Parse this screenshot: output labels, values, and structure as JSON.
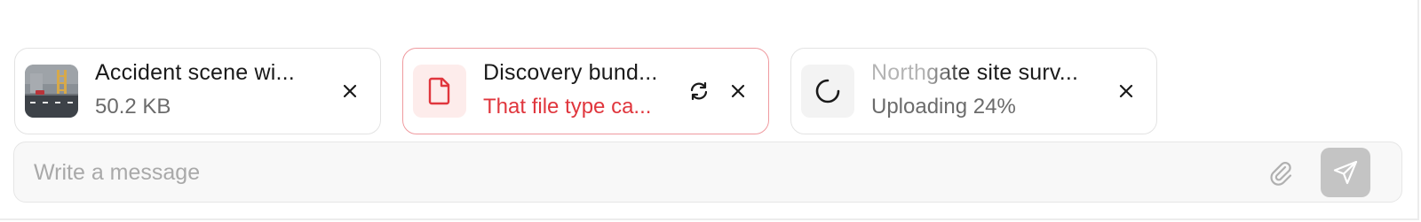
{
  "attachments": [
    {
      "name": "Accident scene wi...",
      "detail": "50.2 KB",
      "status": "uploaded",
      "thumbnail": "road-scene-image",
      "remove_icon": "close-icon"
    },
    {
      "name": "Discovery bund...",
      "detail": "That file type ca...",
      "status": "error",
      "icon": "file-icon",
      "retry_icon": "refresh-icon",
      "remove_icon": "close-icon"
    },
    {
      "name": "Northgate site surv...",
      "detail": "Uploading 24%",
      "status": "uploading",
      "progress_percent": 24,
      "icon": "spinner-icon",
      "remove_icon": "close-icon"
    }
  ],
  "composer": {
    "placeholder": "Write a message",
    "attach_icon": "paperclip-icon",
    "send_icon": "send-icon"
  },
  "colors": {
    "error": "#e0363d",
    "error_border": "#ef9a9f",
    "error_bg": "#fdeceb",
    "send_disabled": "#c4c4c4"
  }
}
